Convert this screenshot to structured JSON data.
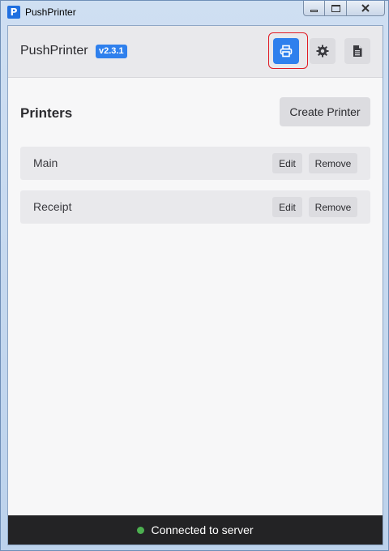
{
  "window": {
    "title": "PushPrinter",
    "icon_letter": "P"
  },
  "header": {
    "brand": "PushPrinter",
    "version": "v2.3.1",
    "buttons": [
      {
        "name": "printers",
        "icon": "printer-icon",
        "active": true
      },
      {
        "name": "settings",
        "icon": "gear-icon",
        "active": false
      },
      {
        "name": "logs",
        "icon": "document-icon",
        "active": false
      }
    ]
  },
  "main": {
    "title": "Printers",
    "create_label": "Create Printer",
    "printers": [
      {
        "name": "Main",
        "edit_label": "Edit",
        "remove_label": "Remove"
      },
      {
        "name": "Receipt",
        "edit_label": "Edit",
        "remove_label": "Remove"
      }
    ]
  },
  "status": {
    "text": "Connected to server",
    "color": "#4caf50"
  },
  "colors": {
    "accent": "#2f80ed",
    "statusbar": "#232325",
    "highlight": "#e01b24"
  }
}
